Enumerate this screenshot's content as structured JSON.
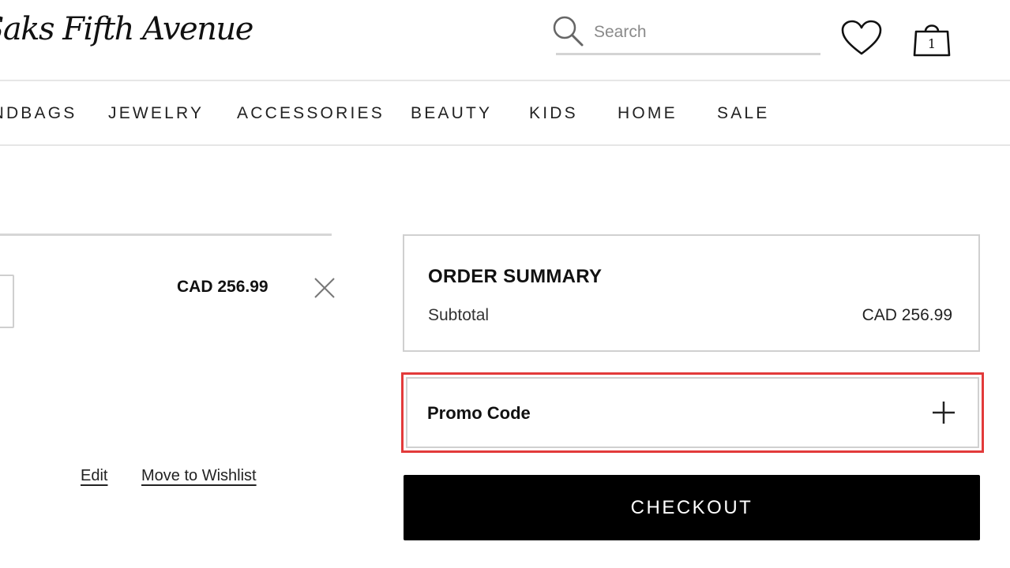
{
  "header": {
    "logo_text": "Saks Fifth Avenue",
    "search": {
      "placeholder": "Search",
      "value": ""
    },
    "icons": {
      "search": "search-icon",
      "wishlist": "heart-icon",
      "bag": "shopping-bag-icon"
    },
    "bag_count": "1"
  },
  "nav": {
    "items": [
      "HANDBAGS",
      "JEWELRY",
      "ACCESSORIES",
      "BEAUTY",
      "KIDS",
      "HOME",
      "SALE"
    ]
  },
  "cart": {
    "item": {
      "price": "CAD 256.99",
      "edit_label": "Edit",
      "wishlist_label": "Move to Wishlist",
      "remove_icon": "close-icon"
    }
  },
  "summary": {
    "title": "ORDER SUMMARY",
    "subtotal_label": "Subtotal",
    "subtotal_value": "CAD 256.99"
  },
  "promo": {
    "label": "Promo Code",
    "icon": "plus-icon"
  },
  "checkout": {
    "label": "CHECKOUT"
  },
  "colors": {
    "accent_highlight": "#e23a3a",
    "checkout_bg": "#000000",
    "divider": "#e6e6e6"
  }
}
